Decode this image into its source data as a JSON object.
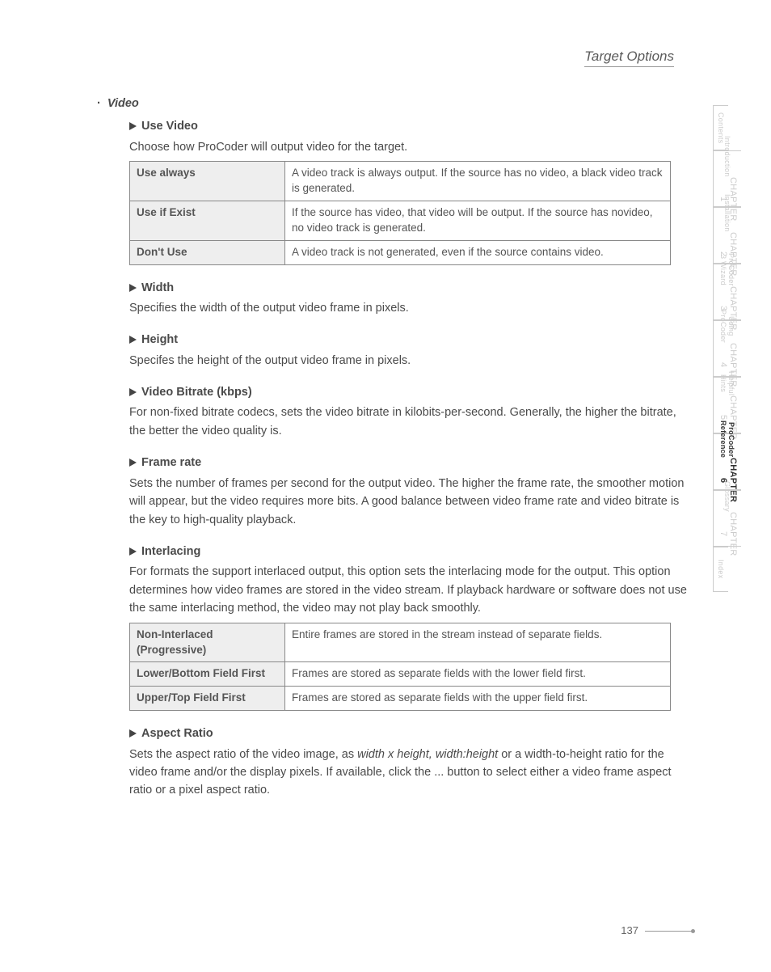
{
  "header": {
    "title": "Target Options"
  },
  "section": {
    "title": "Video"
  },
  "items": {
    "useVideo": {
      "title": "Use Video",
      "desc": "Choose how ProCoder will output video for the target.",
      "rows": [
        {
          "k": "Use always",
          "v": "A video track is always output. If the source has no video, a black video track is generated."
        },
        {
          "k": "Use if Exist",
          "v": "If the source has video, that video will be output. If the source has novideo, no video track is generated."
        },
        {
          "k": "Don't Use",
          "v": "A video track is not generated, even if the source contains video."
        }
      ]
    },
    "width": {
      "title": "Width",
      "desc": "Specifies the width of the output video frame in pixels."
    },
    "height": {
      "title": "Height",
      "desc": "Specifes the height of the output video frame in pixels."
    },
    "bitrate": {
      "title": "Video Bitrate (kbps)",
      "desc": "For non-fixed bitrate codecs, sets the video bitrate in kilobits-per-second. Generally, the higher the bitrate, the better the video quality is."
    },
    "framerate": {
      "title": "Frame rate",
      "desc": "Sets the number of frames per second for the output video. The higher the frame rate, the smoother motion will appear, but the video requires more bits. A good balance between video frame rate and video bitrate is the key to high-quality playback."
    },
    "interlacing": {
      "title": "Interlacing",
      "desc": "For formats the support interlaced output, this option sets the interlacing mode for the output. This option determines how video frames are stored in the video stream. If playback hardware or software does not use the same interlacing method, the video may not play back smoothly.",
      "rows": [
        {
          "k": "Non-Interlaced (Progressive)",
          "v": "Entire frames are stored in the stream instead of separate fields."
        },
        {
          "k": "Lower/Bottom Field First",
          "v": "Frames are stored as separate fields with the lower field first."
        },
        {
          "k": "Upper/Top Field First",
          "v": "Frames are stored as separate fields with the upper field first."
        }
      ]
    },
    "aspect": {
      "title": "Aspect Ratio",
      "desc_pre": "Sets the aspect ratio of the video image, as ",
      "desc_em": "width x height, width:height",
      "desc_post": " or a width-to-height ratio for the video frame and/or the display pixels. If available, click the ... button to select either a video frame aspect ratio or a pixel aspect ratio."
    }
  },
  "tabs": [
    {
      "chapter": "",
      "label": "Contents"
    },
    {
      "chapter": "CHAPTER 1",
      "label": "Introduction"
    },
    {
      "chapter": "CHAPTER 2",
      "label": "Installation"
    },
    {
      "chapter": "CHAPTER 3",
      "label": "ProCoder 3 Wizard"
    },
    {
      "chapter": "CHAPTER 4",
      "label": "Using ProCoder"
    },
    {
      "chapter": "CHAPTER 5",
      "label": "Helpful Hints"
    },
    {
      "chapter": "CHAPTER 6",
      "label": "ProCoder Reference"
    },
    {
      "chapter": "CHAPTER 7",
      "label": "Glossary"
    },
    {
      "chapter": "",
      "label": "Index"
    }
  ],
  "pageNumber": "137"
}
